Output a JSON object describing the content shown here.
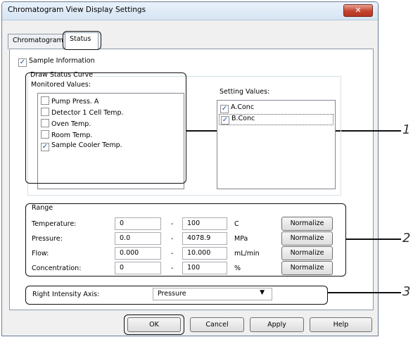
{
  "window": {
    "title": "Chromatogram View Display Settings",
    "close_glyph": "✕"
  },
  "tabs": [
    {
      "label": "Chromatogram"
    },
    {
      "label": "Status"
    }
  ],
  "sample_information": {
    "label": "Sample Information",
    "checked": true
  },
  "draw_status_curve": {
    "label": "Draw Status Curve",
    "monitored_label": "Monitored Values:",
    "monitored": [
      {
        "label": "Pump Press. A",
        "checked": false
      },
      {
        "label": "Detector 1 Cell Temp.",
        "checked": false
      },
      {
        "label": "Oven Temp.",
        "checked": false
      },
      {
        "label": "Room Temp.",
        "checked": false
      },
      {
        "label": "Sample Cooler Temp.",
        "checked": true
      }
    ],
    "setting_label": "Setting Values:",
    "setting": [
      {
        "label": "A.Conc",
        "checked": true
      },
      {
        "label": "B.Conc",
        "checked": true
      }
    ]
  },
  "range": {
    "label": "Range",
    "rows": [
      {
        "name": "Temperature:",
        "min": "0",
        "dash": "-",
        "max": "100",
        "unit": "C",
        "button": "Normalize"
      },
      {
        "name": "Pressure:",
        "min": "0.0",
        "dash": "-",
        "max": "4078.9",
        "unit": "MPa",
        "button": "Normalize"
      },
      {
        "name": "Flow:",
        "min": "0.000",
        "dash": "-",
        "max": "10.000",
        "unit": "mL/min",
        "button": "Normalize"
      },
      {
        "name": "Concentration:",
        "min": "0",
        "dash": "-",
        "max": "100",
        "unit": "%",
        "button": "Normalize"
      }
    ]
  },
  "right_axis": {
    "label": "Right Intensity Axis:",
    "value": "Pressure"
  },
  "buttons": {
    "ok": "OK",
    "cancel": "Cancel",
    "apply": "Apply",
    "help": "Help"
  },
  "callouts": [
    "1",
    "2",
    "3"
  ]
}
